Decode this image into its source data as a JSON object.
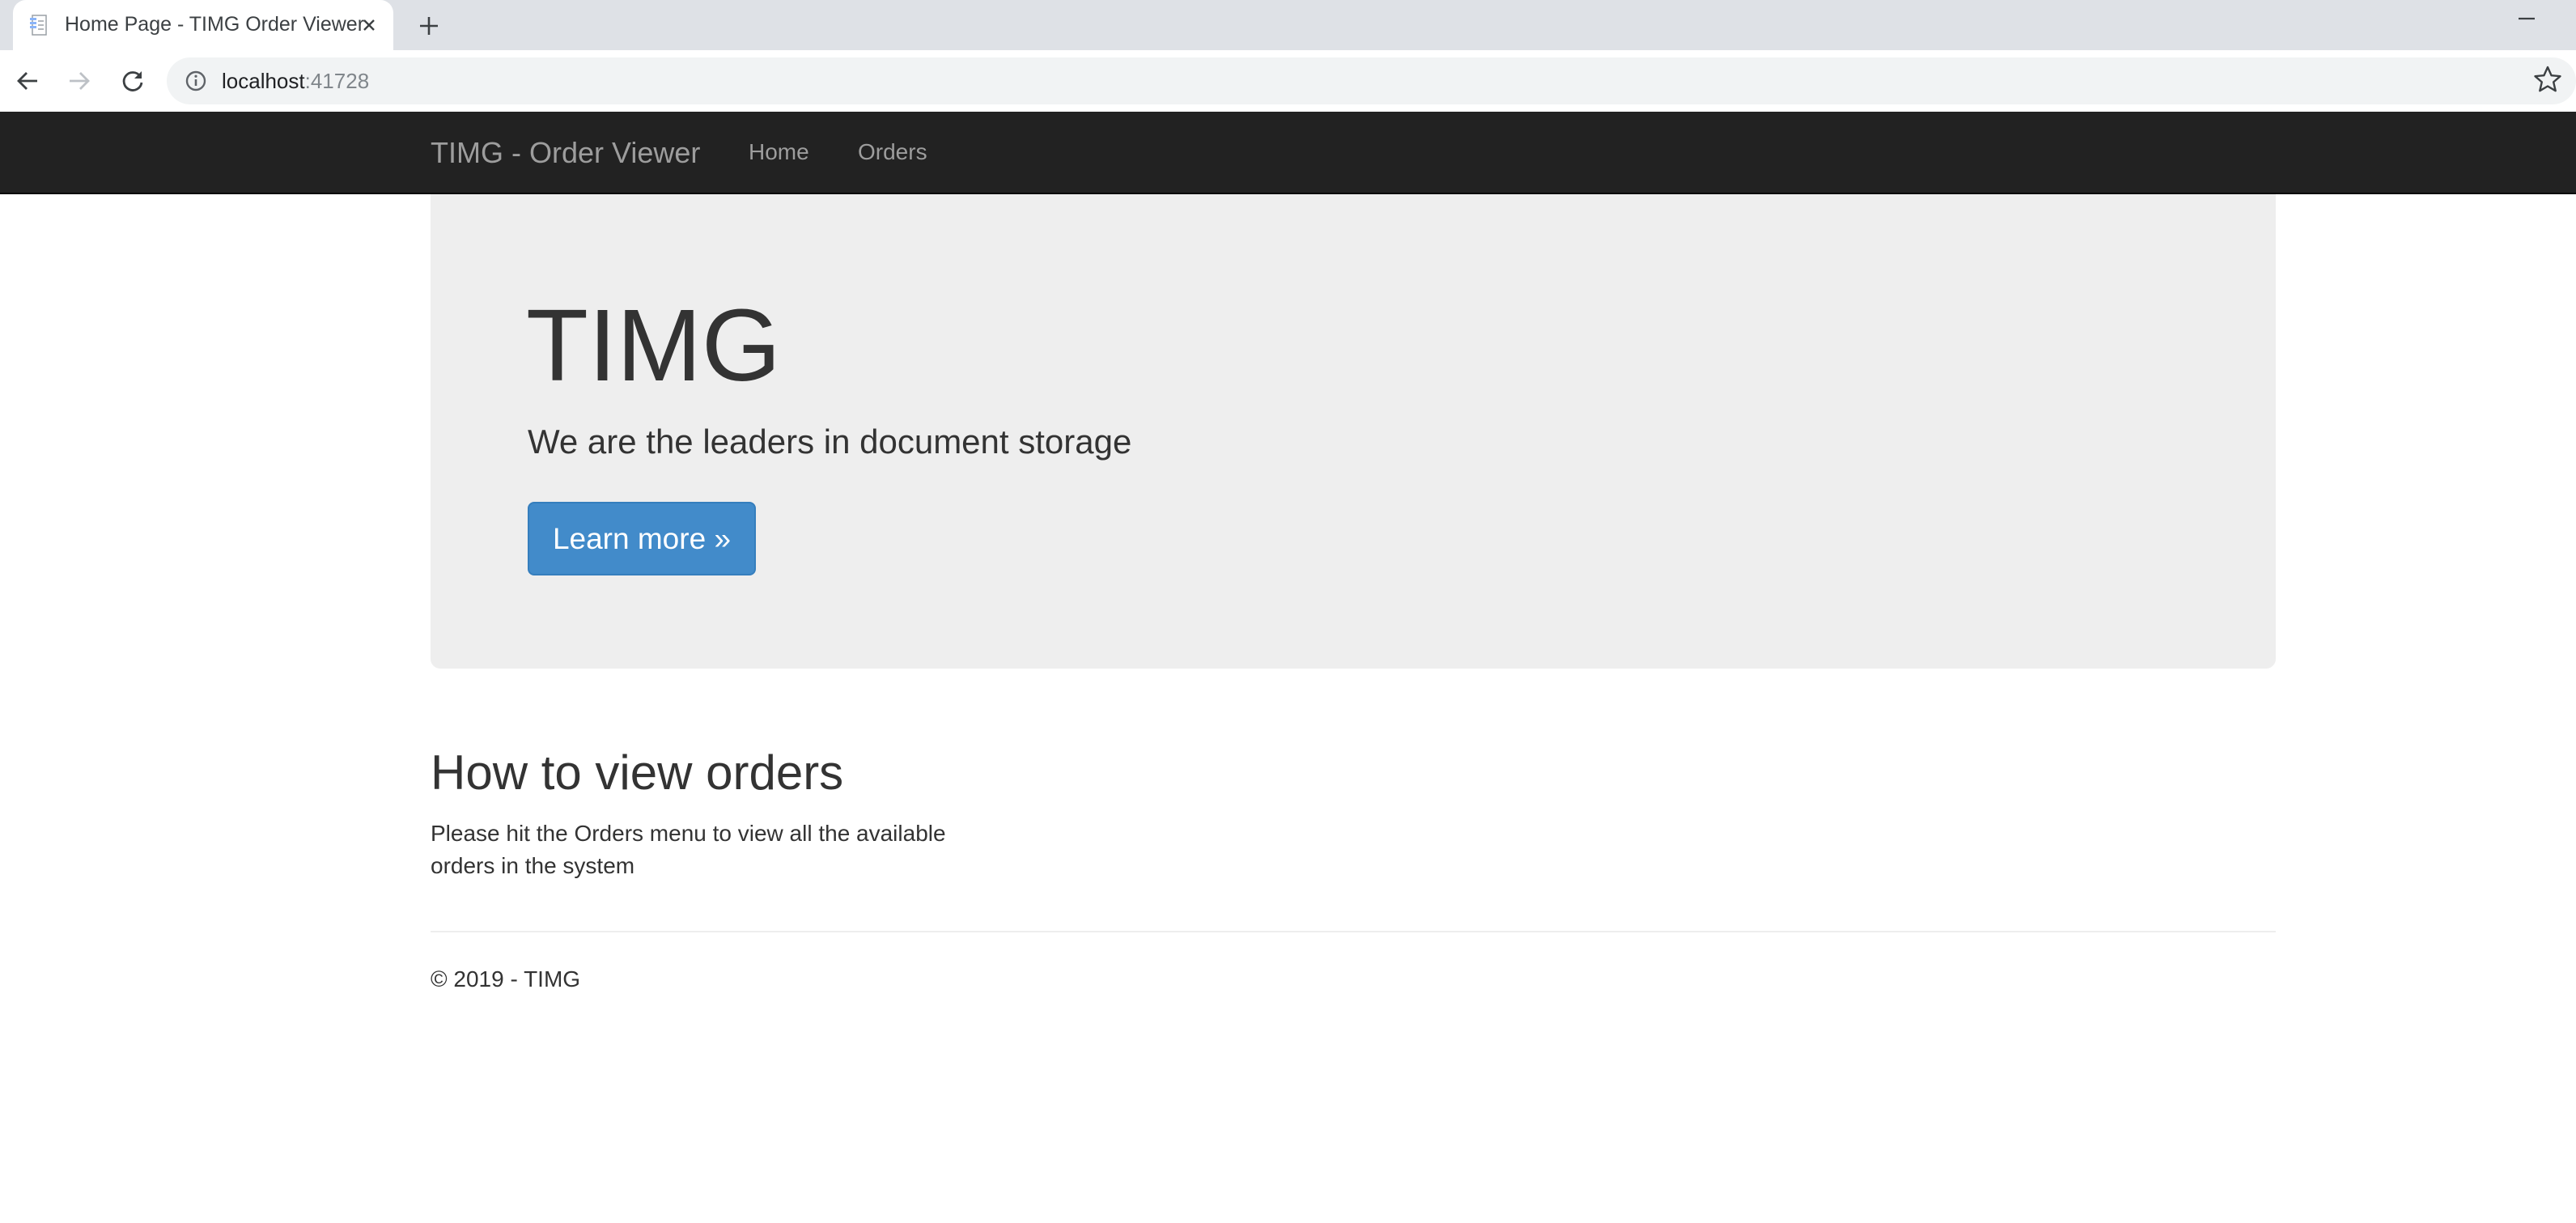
{
  "browser": {
    "tab_title": "Home Page - TIMG Order Viewer",
    "url_host": "localhost",
    "url_port": ":41728",
    "icons": {
      "favicon": "document-icon",
      "close": "close-icon",
      "new_tab": "plus-icon",
      "minimize": "minimize-icon",
      "back": "back-arrow-icon",
      "forward": "forward-arrow-icon",
      "reload": "reload-icon",
      "site_info": "info-icon",
      "bookmark": "star-icon"
    }
  },
  "navbar": {
    "brand": "TIMG - Order Viewer",
    "links": [
      "Home",
      "Orders"
    ]
  },
  "jumbotron": {
    "title": "TIMG",
    "lead": "We are the leaders in document storage",
    "button_label": "Learn more »"
  },
  "section": {
    "heading": "How to view orders",
    "body": "Please hit the Orders menu to view all the available orders in the system"
  },
  "footer": {
    "text": "© 2019 - TIMG"
  },
  "colors": {
    "navbar_bg": "#222222",
    "navbar_text": "#9d9d9d",
    "jumbotron_bg": "#eeeeee",
    "button_bg": "#428bca"
  }
}
